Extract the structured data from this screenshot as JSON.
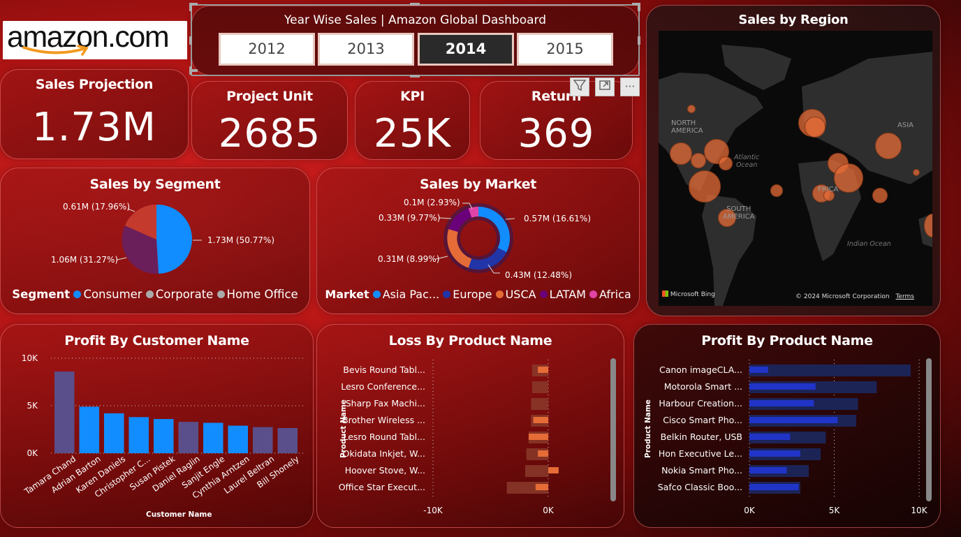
{
  "logo": {
    "text": "amazon.com"
  },
  "year_slicer": {
    "title": "Year Wise Sales | Amazon Global Dashboard",
    "years": [
      "2012",
      "2013",
      "2014",
      "2015"
    ],
    "selected": "2014"
  },
  "kpis": {
    "sales_projection": {
      "label": "Sales Projection",
      "value": "1.73M"
    },
    "project_unit": {
      "label": "Project Unit",
      "value": "2685"
    },
    "kpi": {
      "label": "KPI",
      "value": "25K"
    },
    "return": {
      "label": "Return",
      "value": "369"
    }
  },
  "visual_header_icons": [
    "filter-icon",
    "focus-mode-icon",
    "more-options-icon"
  ],
  "sales_by_segment": {
    "title": "Sales by Segment",
    "legend_title": "Segment",
    "labels": {
      "consumer": "1.73M (50.77%)",
      "corporate": "1.06M (31.27%)",
      "home_office": "0.61M (17.96%)"
    },
    "legend": [
      "Consumer",
      "Corporate",
      "Home Office"
    ],
    "colors": {
      "consumer": "#118dff",
      "corporate": "#6b1f5a",
      "home_office": "#c43b2e"
    }
  },
  "sales_by_market": {
    "title": "Sales by Market",
    "legend_title": "Market",
    "labels": [
      "0.57M (16.61%)",
      "0.43M (12.48%)",
      "0.31M (8.99%)",
      "0.33M (9.77%)",
      "0.1M (2.93%)"
    ],
    "legend": [
      "Asia Pac...",
      "Europe",
      "USCA",
      "LATAM",
      "Africa"
    ],
    "colors": [
      "#118dff",
      "#2134a8",
      "#e66c37",
      "#6b007b",
      "#e044a7"
    ]
  },
  "sales_by_region": {
    "title": "Sales by Region",
    "map_labels": {
      "north_america": "NORTH\nAMERICA",
      "south_america": "SOUTH\nAMERICA",
      "asia": "ASIA",
      "atlantic": "Atlantic\nOcean",
      "indian": "Indian Ocean",
      "africa": "FRICA"
    },
    "attribution": "© 2024 Microsoft Corporation",
    "terms": "Terms",
    "bing": "Microsoft Bing"
  },
  "profit_by_customer": {
    "title": "Profit By Customer Name",
    "xlabel": "Customer Name",
    "y_ticks": [
      "10K",
      "5K",
      "0K"
    ]
  },
  "loss_by_product": {
    "title": "Loss By Product Name",
    "ylabel": "Product Name",
    "x_ticks": [
      "-10K",
      "0K"
    ],
    "names": [
      "Bevis Round Tabl...",
      "Lesro Conference...",
      "Sharp Fax Machi...",
      "Brother Wireless ...",
      "Lesro Round Tabl...",
      "Okidata Inkjet, W...",
      "Hoover Stove, W...",
      "Office Star Execut..."
    ]
  },
  "profit_by_product": {
    "title": "Profit By Product Name",
    "ylabel": "Product Name",
    "x_ticks": [
      "0K",
      "5K",
      "10K"
    ],
    "names": [
      "Canon imageCLA...",
      "Motorola Smart ...",
      "Harbour Creation...",
      "Cisco Smart Pho...",
      "Belkin Router, USB",
      "Hon Executive Le...",
      "Nokia Smart Pho...",
      "Safco Classic Boo..."
    ]
  },
  "chart_data": [
    {
      "type": "pie",
      "title": "Sales by Segment",
      "categories": [
        "Consumer",
        "Corporate",
        "Home Office"
      ],
      "values": [
        1.73,
        1.06,
        0.61
      ],
      "percent": [
        50.77,
        31.27,
        17.96
      ]
    },
    {
      "type": "pie",
      "title": "Sales by Market",
      "categories": [
        "Asia Pac...",
        "Europe",
        "USCA",
        "LATAM",
        "Africa"
      ],
      "values": [
        0.57,
        0.43,
        0.31,
        0.33,
        0.1
      ],
      "percent": [
        16.61,
        12.48,
        8.99,
        9.77,
        2.93
      ]
    },
    {
      "type": "bar",
      "title": "Profit By Customer Name",
      "xlabel": "Customer Name",
      "categories": [
        "Tamara Chand",
        "Adrian Barton",
        "Karen Daniels",
        "Christopher C...",
        "Susan Pistek",
        "Daniel Raglin",
        "Sanjit Engle",
        "Cynthia Arntzen",
        "Laurel Beltran",
        "Bill Shonely"
      ],
      "values": [
        8600,
        4900,
        4200,
        3800,
        3600,
        3300,
        3200,
        2900,
        2750,
        2650
      ],
      "ylim": [
        0,
        10000
      ],
      "highlighted": [
        false,
        true,
        true,
        true,
        true,
        false,
        true,
        true,
        false,
        false
      ]
    },
    {
      "type": "bar",
      "title": "Loss By Product Name",
      "ylabel": "Product Name",
      "categories": [
        "Bevis Round Tabl...",
        "Lesro Conference...",
        "Sharp Fax Machi...",
        "Brother Wireless ...",
        "Lesro Round Tabl...",
        "Okidata Inkjet, W...",
        "Hoover Stove, W...",
        "Office Star Execut..."
      ],
      "values": [
        -1400,
        -1400,
        -1500,
        -1500,
        -1700,
        -1900,
        -2000,
        -3600
      ],
      "highlight_values": [
        -900,
        0,
        0,
        -1300,
        -1700,
        -900,
        900,
        -1100
      ],
      "xlim": [
        -10000,
        0
      ]
    },
    {
      "type": "bar",
      "title": "Profit By Product Name",
      "ylabel": "Product Name",
      "categories": [
        "Canon imageCLA...",
        "Motorola Smart ...",
        "Harbour Creation...",
        "Cisco Smart Pho...",
        "Belkin Router, USB",
        "Hon Executive Le...",
        "Nokia Smart Pho...",
        "Safco Classic Boo..."
      ],
      "values": [
        9500,
        7500,
        6400,
        6300,
        4500,
        4200,
        3500,
        3000
      ],
      "highlight_values": [
        1100,
        3900,
        3800,
        5200,
        2400,
        3000,
        2200,
        2900
      ],
      "xlim": [
        0,
        10000
      ]
    }
  ]
}
